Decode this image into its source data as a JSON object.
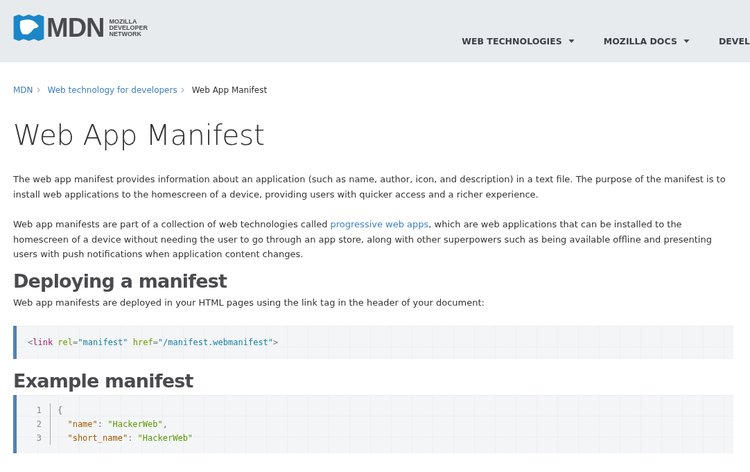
{
  "header": {
    "logo": {
      "wordmark": "MDN",
      "subtitle": [
        "MOZILLA",
        "DEVELOPER",
        "NETWORK"
      ]
    },
    "nav": [
      {
        "label": "WEB TECHNOLOGIES",
        "caret": true
      },
      {
        "label": "MOZILLA DOCS",
        "caret": true
      },
      {
        "label": "DEVEL",
        "caret": false
      }
    ]
  },
  "breadcrumbs": [
    {
      "label": "MDN",
      "link": true
    },
    {
      "label": "Web technology for developers",
      "link": true
    },
    {
      "label": "Web App Manifest",
      "link": false
    }
  ],
  "title": "Web App Manifest",
  "sections": [
    {
      "kind": "paragraph",
      "parts": [
        {
          "text": "The web app manifest provides information about an application (such as name, author, icon, and description) in a text file. The purpose of the manifest is to install web applications to the homescreen of a device, providing users with quicker access and a richer experience.",
          "kind": "text"
        }
      ]
    },
    {
      "kind": "paragraph",
      "parts": [
        {
          "text": "Web app manifests are part of a collection of web technologies called ",
          "kind": "text"
        },
        {
          "text": "progressive web apps",
          "kind": "link"
        },
        {
          "text": ", which are web applications that can be installed to the homescreen of a device without needing the user to go through an app store, along with other superpowers such as  being available offline and presenting users with push notifications when application content changes.",
          "kind": "text"
        }
      ]
    },
    {
      "kind": "heading",
      "text": "Deploying a manifest"
    },
    {
      "kind": "paragraph",
      "parts": [
        {
          "text": "Web app manifests are deployed in your HTML pages using the link tag in the header of your document:",
          "kind": "text"
        }
      ]
    },
    {
      "kind": "code",
      "lines": [
        {
          "tokens": [
            {
              "text": "<",
              "kind": "punct"
            },
            {
              "text": "link",
              "kind": "tag"
            },
            {
              "text": " rel",
              "kind": "attr"
            },
            {
              "text": "=",
              "kind": "punct"
            },
            {
              "text": "\"manifest\"",
              "kind": "string"
            },
            {
              "text": " href",
              "kind": "attr"
            },
            {
              "text": "=",
              "kind": "punct"
            },
            {
              "text": "\"/manifest.webmanifest\"",
              "kind": "string"
            },
            {
              "text": ">",
              "kind": "punct"
            }
          ]
        }
      ]
    },
    {
      "kind": "heading",
      "text": "Example manifest"
    },
    {
      "kind": "code",
      "lines": [
        {
          "number": "1",
          "tokens": [
            {
              "text": "{",
              "kind": "punct"
            }
          ]
        },
        {
          "number": "2",
          "tokens": [
            {
              "text": "  \"name\"",
              "kind": "key"
            },
            {
              "text": ": ",
              "kind": "punct"
            },
            {
              "text": "\"HackerWeb\"",
              "kind": "value"
            },
            {
              "text": ",",
              "kind": "punct"
            }
          ]
        },
        {
          "number": "3",
          "tokens": [
            {
              "text": "  \"short_name\"",
              "kind": "key"
            },
            {
              "text": ": ",
              "kind": "punct"
            },
            {
              "text": "\"HackerWeb\"",
              "kind": "value"
            }
          ]
        }
      ]
    }
  ]
}
